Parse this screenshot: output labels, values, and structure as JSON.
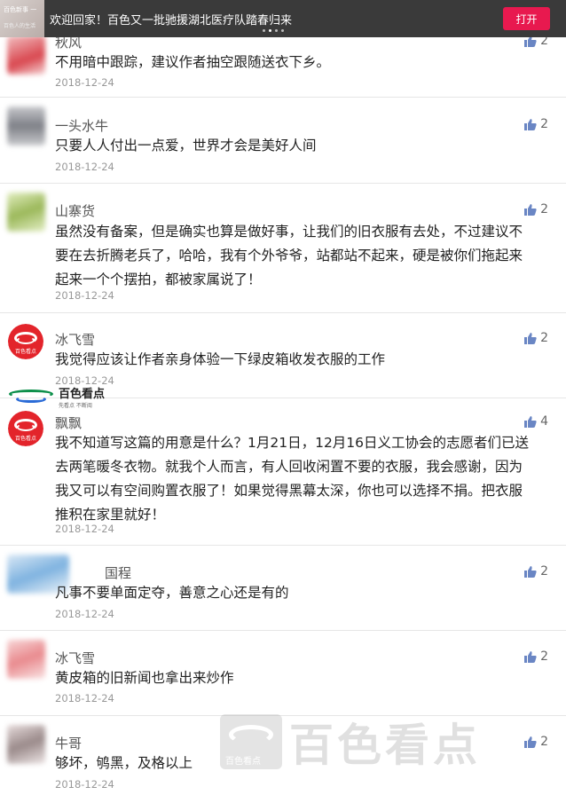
{
  "banner": {
    "thumb_text_1": "百色新事 一",
    "thumb_text_2": "百色人的生活",
    "title": "欢迎回家！百色又一批驰援湖北医疗队踏春归来",
    "open_label": "打开"
  },
  "comments": [
    {
      "name": "秋风",
      "likes": "2",
      "lines": [
        "不用暗中跟踪，建议作者抽空跟随送衣下乡。"
      ],
      "date": "2018-12-24",
      "avatar_color": "#e0666a"
    },
    {
      "name": "一头水牛",
      "likes": "2",
      "lines": [
        "只要人人付出一点爱，世界才会是美好人间"
      ],
      "date": "2018-12-24",
      "avatar_color": "#8e9095"
    },
    {
      "name": "山寨货",
      "likes": "2",
      "lines": [
        "虽然没有备案，但是确实也算是做好事，让我们的旧衣服有去处，不过建议不",
        "要在去折腾老兵了，哈哈，我有个外爷爷，站都站不起来，硬是被你们拖起来",
        "起来一个个摆拍，都被家属说了！"
      ],
      "date": "2018-12-24",
      "avatar_color": "#a9c46a"
    },
    {
      "name": "冰飞雪",
      "likes": "2",
      "lines": [
        "我觉得应该让作者亲身体验一下绿皮箱收发衣服的工作"
      ],
      "date": "2018-12-24",
      "avatar_color": "#e3242b",
      "logo_text": "百色看点"
    },
    {
      "name": "飘飘",
      "likes": "4",
      "lines": [
        "我不知道写这篇的用意是什么？1月21日，12月16日义工协会的志愿者们已送",
        "去两笔暖冬衣物。就我个人而言，有人回收闲置不要的衣服，我会感谢，因为",
        "我又可以有空间购置衣服了！如果觉得黑幕太深，你也可以选择不捐。把衣服",
        "推积在家里就好！"
      ],
      "date": "2018-12-24",
      "avatar_color": "#e3242b",
      "logo_text": "百色看点"
    },
    {
      "name": "国程",
      "likes": "2",
      "lines": [
        "凡事不要单面定夺，善意之心还是有的"
      ],
      "date": "2018-12-24",
      "avatar_color": "#7fb3e0"
    },
    {
      "name": "冰飞雪",
      "likes": "2",
      "lines": [
        "黄皮箱的旧新闻也拿出来炒作"
      ],
      "date": "2018-12-24",
      "avatar_color": "#e98a8e"
    },
    {
      "name": "牛哥",
      "likes": "2",
      "lines": [
        "够坏，鸲黑，及格以上"
      ],
      "date": "2018-12-24",
      "avatar_color": "#9a8a8a"
    }
  ],
  "watermark_mid": {
    "name": "百色看点",
    "sub": "先看点 不断阅"
  },
  "watermark_bottom": {
    "badge": "百色看点",
    "big": "百色看点"
  },
  "colors": {
    "accent": "#e8194f",
    "like_icon": "#6a86c4"
  }
}
